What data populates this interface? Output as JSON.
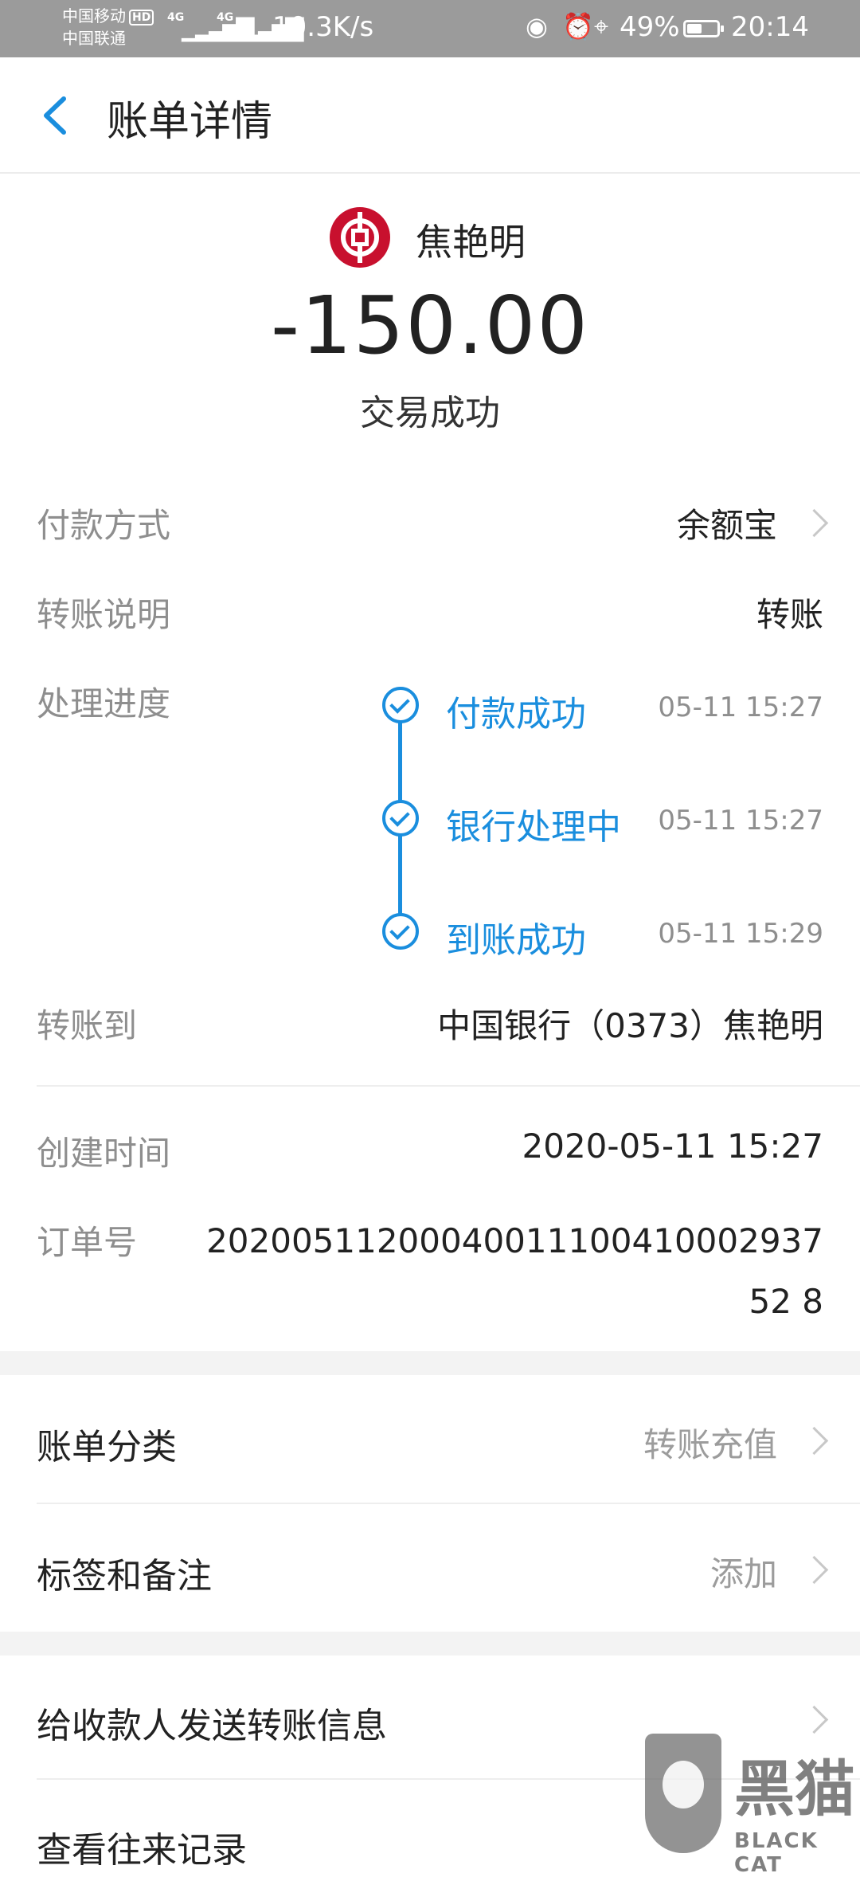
{
  "status_bar": {
    "carrier_1": "中国移动",
    "hd_badge": "HD",
    "carrier_2": "中国联通",
    "network_1": "4G",
    "network_2": "4G",
    "speed": "10.3K/s",
    "battery": "49%",
    "time": "20:14"
  },
  "header": {
    "title": "账单详情"
  },
  "payee": {
    "name": "焦艳明"
  },
  "transaction": {
    "amount": "-150.00",
    "status": "交易成功"
  },
  "details": {
    "payment_method_label": "付款方式",
    "payment_method_value": "余额宝",
    "transfer_note_label": "转账说明",
    "transfer_note_value": "转账",
    "progress_label": "处理进度",
    "steps": [
      {
        "label": "付款成功",
        "time": "05-11 15:27"
      },
      {
        "label": "银行处理中",
        "time": "05-11 15:27"
      },
      {
        "label": "到账成功",
        "time": "05-11 15:29"
      }
    ],
    "transfer_to_label": "转账到",
    "transfer_to_value": "中国银行（0373）焦艳明",
    "created_time_label": "创建时间",
    "created_time_value": "2020-05-11 15:27",
    "order_no_label": "订单号",
    "order_no_value": "2020051120004001110041000293752 8"
  },
  "menu": {
    "category_label": "账单分类",
    "category_value": "转账充值",
    "tags_label": "标签和备注",
    "tags_value": "添加",
    "send_info_label": "给收款人发送转账信息",
    "history_label": "查看往来记录"
  },
  "watermark": {
    "cn": "黑猫",
    "en": "BLACK CAT"
  }
}
